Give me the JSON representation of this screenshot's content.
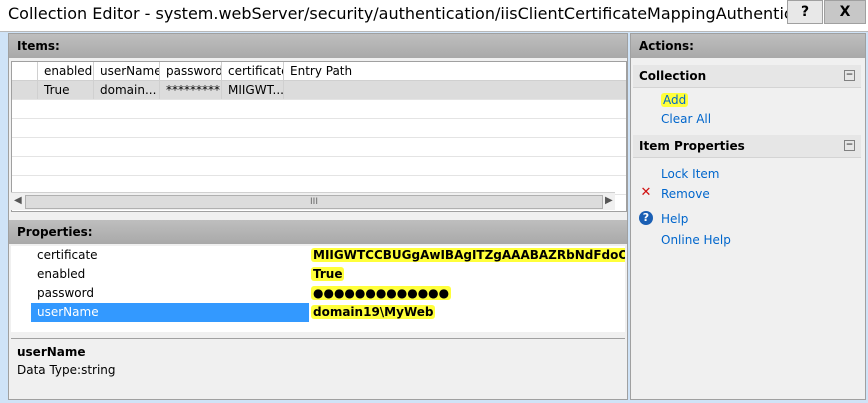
{
  "window": {
    "title": "Collection Editor - system.webServer/security/authentication/iisClientCertificateMappingAuthentication/oneToOneM...",
    "help_label": "?",
    "close_label": "X"
  },
  "items": {
    "header": "Items:",
    "columns": [
      "enabled",
      "userName",
      "password",
      "certificate",
      "Entry Path"
    ],
    "rows": [
      {
        "enabled": "True",
        "userName": "domain...",
        "password": "*********...",
        "certificate": "MIIGWT...",
        "entry_path": ""
      }
    ],
    "scroll_label": "III"
  },
  "properties": {
    "header": "Properties:",
    "rows": [
      {
        "name": "certificate",
        "value": "MIIGWTCCBUGgAwIBAgITZgAAABAZRbNdFdoOXQAAA"
      },
      {
        "name": "enabled",
        "value": "True"
      },
      {
        "name": "password",
        "value": "●●●●●●●●●●●●●"
      },
      {
        "name": "userName",
        "value": "domain19\\MyWeb"
      }
    ]
  },
  "description": {
    "name": "userName",
    "type": "Data Type:string"
  },
  "actions": {
    "header": "Actions:",
    "collection": {
      "title": "Collection",
      "add": "Add",
      "clear_all": "Clear All"
    },
    "item_properties": {
      "title": "Item Properties",
      "lock_item": "Lock Item",
      "remove": "Remove"
    },
    "help": "Help",
    "online_help": "Online Help"
  },
  "colors": {
    "highlight": "#ffff3b",
    "selection": "#3399ff",
    "link": "#0066cc"
  }
}
